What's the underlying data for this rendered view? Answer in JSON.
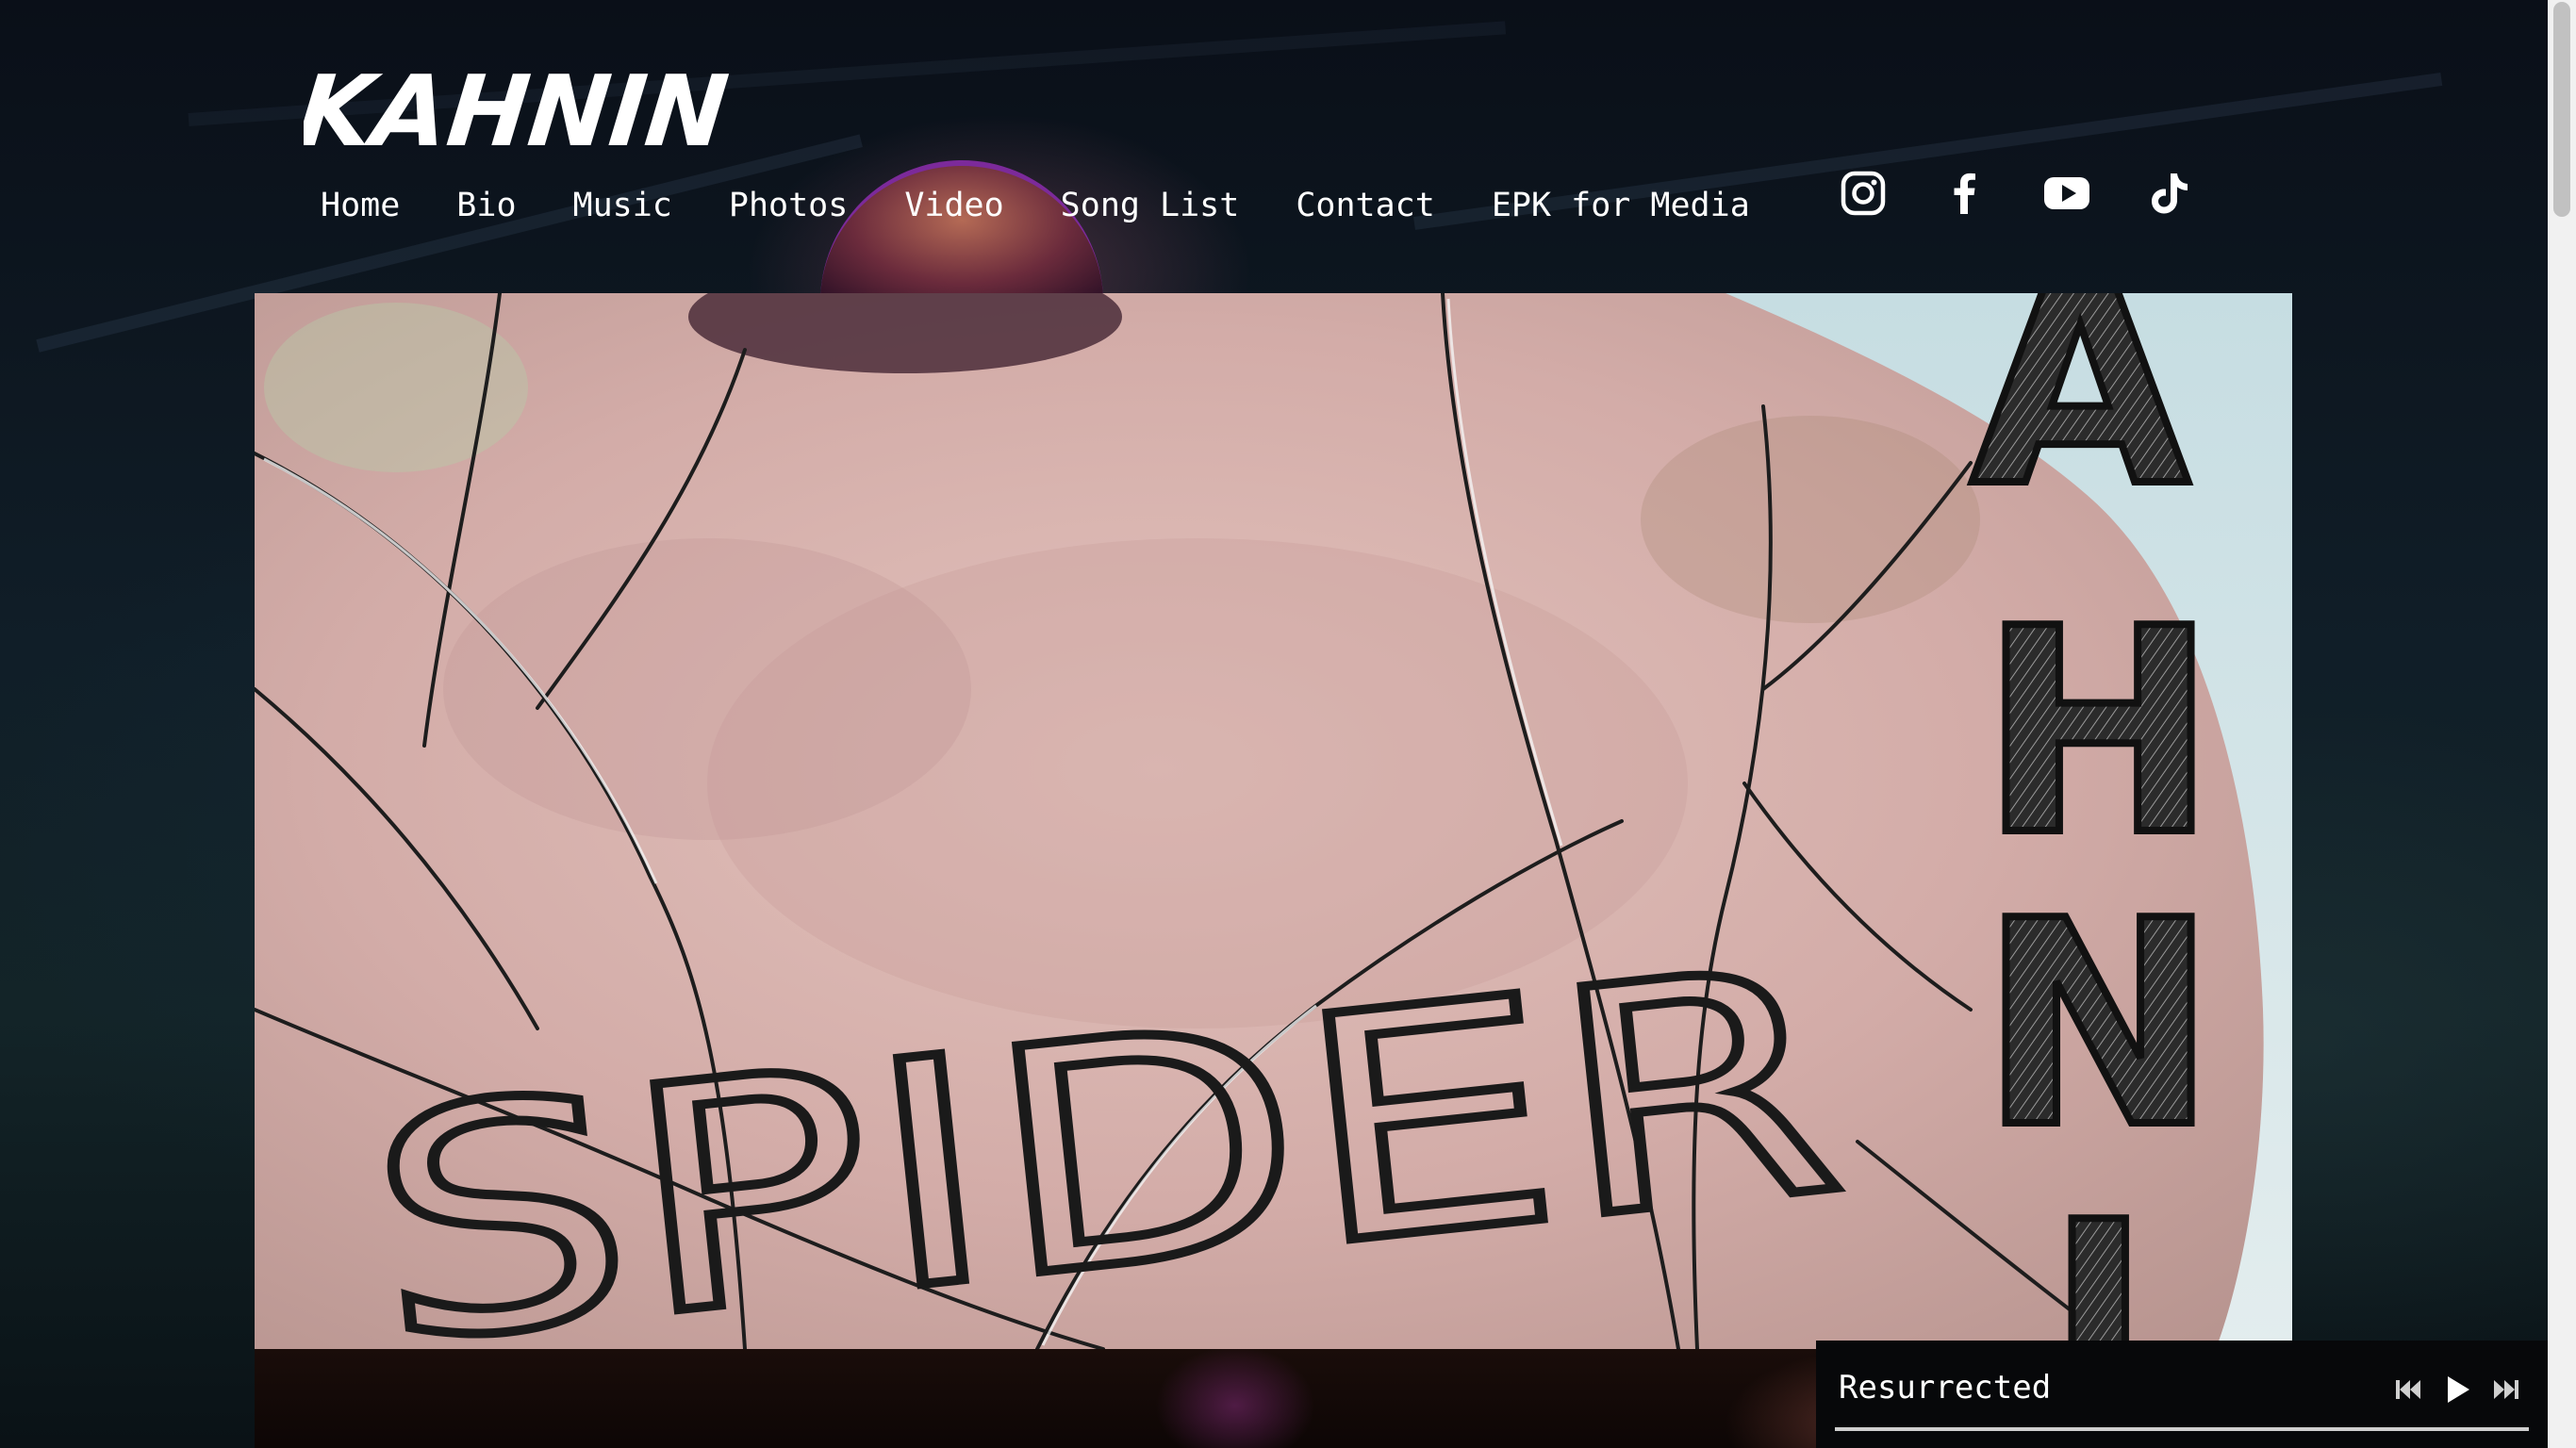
{
  "site": {
    "logo_text": "KAHNIN"
  },
  "nav": {
    "items": [
      {
        "label": "Home"
      },
      {
        "label": "Bio"
      },
      {
        "label": "Music"
      },
      {
        "label": "Photos"
      },
      {
        "label": "Video"
      },
      {
        "label": "Song List"
      },
      {
        "label": "Contact"
      },
      {
        "label": "EPK for Media"
      }
    ]
  },
  "social": {
    "icons": [
      "instagram-icon",
      "facebook-icon",
      "youtube-icon",
      "tiktok-icon"
    ]
  },
  "hero": {
    "art_word": "SPIDER",
    "art_side_letters": [
      "A",
      "H",
      "N",
      "I"
    ]
  },
  "player": {
    "track_title": "Resurrected",
    "progress": 0
  },
  "colors": {
    "page_background": "#0b1219",
    "text": "#ffffff",
    "player_background": "#07080a",
    "skin": "#d8b3ad"
  }
}
